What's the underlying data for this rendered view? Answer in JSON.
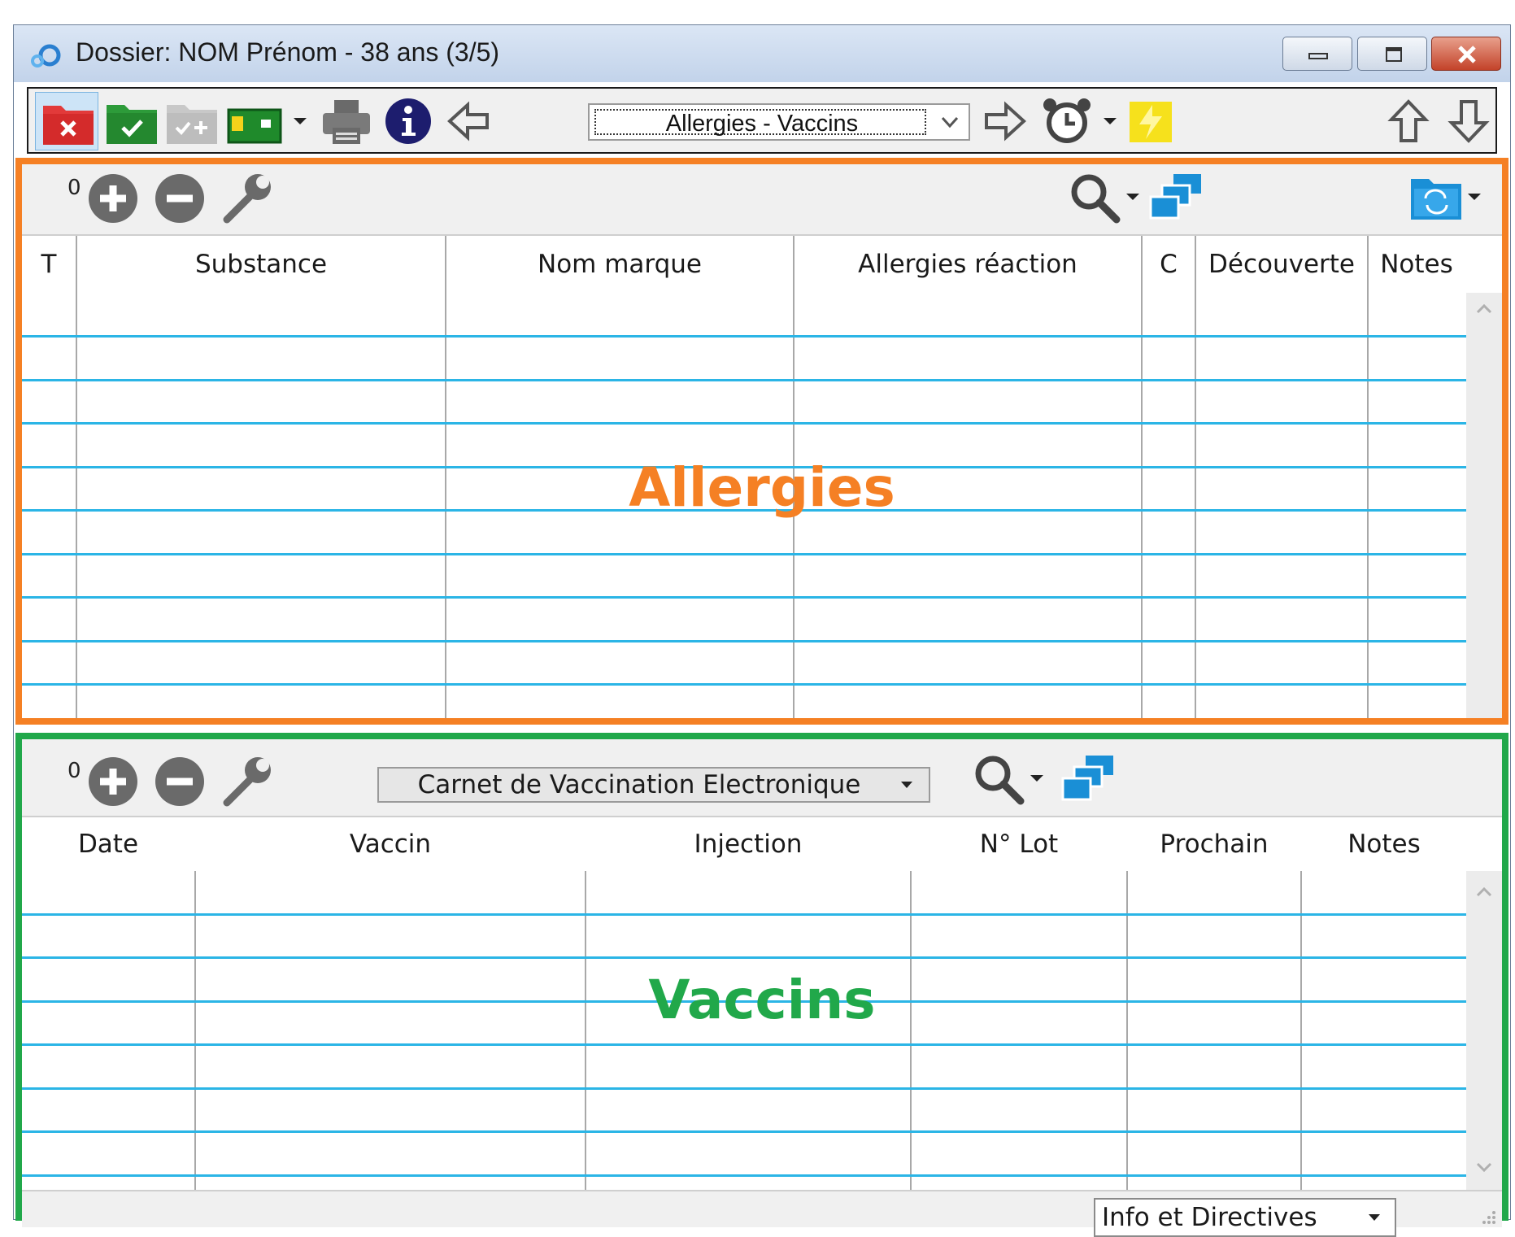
{
  "window": {
    "title": "Dossier: NOM Prénom - 38 ans (3/5)"
  },
  "toolbar": {
    "nav_select_value": "Allergies - Vaccins",
    "icons": [
      "folder-close-icon",
      "folder-validate-icon",
      "folder-add-icon",
      "card-reader-icon",
      "dropdown-arrow-icon",
      "printer-icon",
      "info-icon",
      "arrow-left-icon",
      "arrow-right-icon",
      "alarm-clock-icon",
      "dropdown-arrow-icon",
      "lightning-note-icon",
      "arrow-up-icon",
      "arrow-down-icon"
    ]
  },
  "allergies": {
    "overlay_label": "Allergies",
    "overlay_color": "#f58024",
    "count": "0",
    "columns": [
      "T",
      "Substance",
      "Nom marque",
      "Allergies réaction",
      "C",
      "Découverte",
      "Notes"
    ],
    "rows": []
  },
  "vaccins": {
    "overlay_label": "Vaccins",
    "overlay_color": "#21a84a",
    "count": "0",
    "carnet_select_value": "Carnet de Vaccination Electronique",
    "columns": [
      "Date",
      "Vaccin",
      "Injection",
      "N° Lot",
      "Prochain",
      "Notes"
    ],
    "rows": []
  },
  "statusbar": {
    "info_select_value": "Info et Directives"
  },
  "colors": {
    "row_line": "#2bb5e6",
    "accent_blue": "#1a8fd6"
  }
}
